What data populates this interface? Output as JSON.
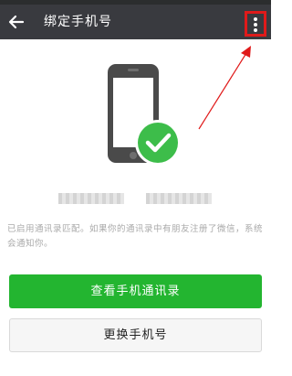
{
  "header": {
    "title": "绑定手机号",
    "back_icon": "back-arrow-icon",
    "more_icon": "more-vertical-icon"
  },
  "hero": {
    "icon": "phone-check-icon"
  },
  "match_info": {
    "description": "已启用通讯录匹配。如果你的通讯录中有朋友注册了微信，系统会通知你。"
  },
  "actions": {
    "view_contacts_label": "查看手机通讯录",
    "change_phone_label": "更换手机号"
  },
  "colors": {
    "appbar": "#393a3f",
    "primary_button": "#23b530",
    "check_badge": "#3dbd4a",
    "phone_body": "#4a4a4a",
    "highlight": "#e01a1a"
  }
}
